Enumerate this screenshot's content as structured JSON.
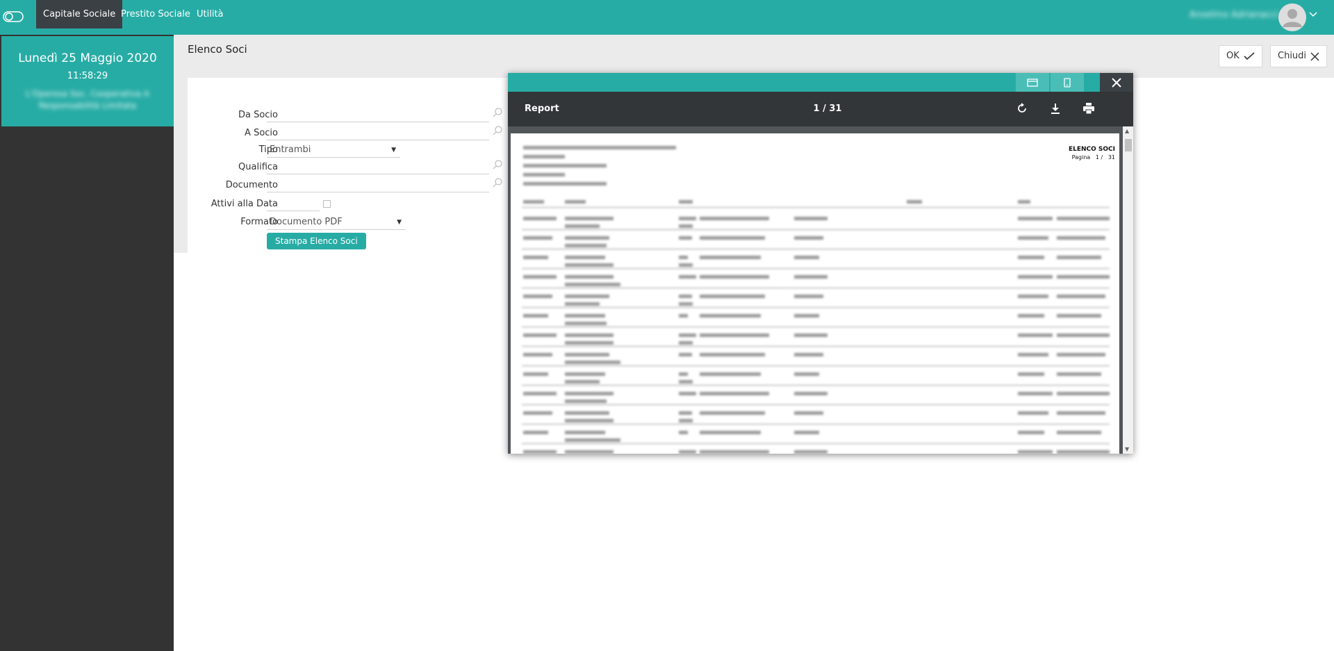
{
  "nav": {
    "tabs": [
      {
        "label": "Capitale Sociale"
      },
      {
        "label": "Prestito Sociale"
      },
      {
        "label": "Utilità"
      }
    ],
    "user_name": "Anselmo Adrianacci"
  },
  "sidebar": {
    "date": "Lunedì 25 Maggio 2020",
    "time": "11:58:29",
    "company": "L'Operosa Soc. Cooperativa A Responsabilità Limitata"
  },
  "page": {
    "title": "Elenco Soci",
    "ok_label": "OK",
    "close_label": "Chiudi"
  },
  "form": {
    "da_socio_label": "Da Socio",
    "a_socio_label": "A Socio",
    "tipo_label": "Tipo",
    "tipo_value": "Entrambi",
    "qualifica_label": "Qualifica",
    "documento_label": "Documento",
    "attivi_label": "Attivi alla Data",
    "formato_label": "Formato",
    "formato_value": "Documento PDF",
    "submit_label": "Stampa Elenco Soci"
  },
  "report": {
    "title": "Report",
    "page_indicator": "1 / 31",
    "doc_heading": "ELENCO SOCI",
    "doc_page_label": "Pagina",
    "doc_page_value": "1 /",
    "doc_page_total": "31"
  },
  "colors": {
    "accent": "#27aca5",
    "dark": "#333333",
    "nav_active": "#3b4045",
    "viewer_toolbar": "#323639"
  }
}
